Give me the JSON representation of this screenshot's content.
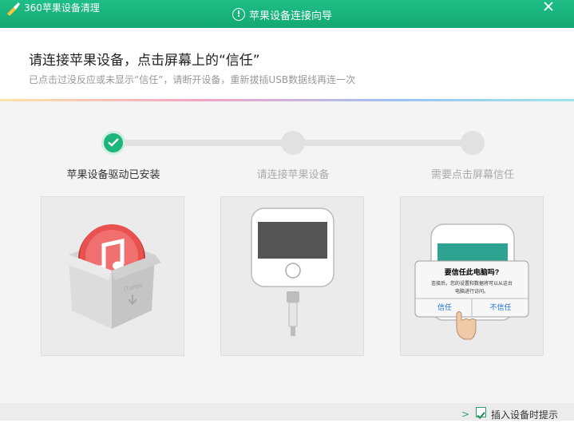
{
  "window": {
    "title": "360苹果设备清理",
    "wizard_title": "苹果设备连接向导",
    "wizard_icon": "alert-circle-icon",
    "close_icon": "close-icon"
  },
  "header": {
    "headline": "请连接苹果设备，点击屏幕上的“信任”",
    "subline": "已点击过没反应或未显示“信任”，请断开设备，重新拔插USB数据线再连一次"
  },
  "steps": [
    {
      "label": "苹果设备驱动已安装",
      "status": "done"
    },
    {
      "label": "请连接苹果设备",
      "status": "pending"
    },
    {
      "label": "需要点击屏幕信任",
      "status": "pending"
    }
  ],
  "trust_dialog": {
    "title": "要信任此电脑吗?",
    "body_line1": "连接后，您的设置和数据将可以从这台",
    "body_line2": "电脑进行访问。",
    "trust_label": "信任",
    "dont_trust_label": "不信任"
  },
  "itunes": {
    "box_text": "iTunes"
  },
  "footer": {
    "checkbox_label": "插入设备时提示",
    "checked": true
  },
  "colors": {
    "accent": "#1cb67c",
    "title_bar": "#14a872",
    "itunes_red": "#e8514f"
  }
}
